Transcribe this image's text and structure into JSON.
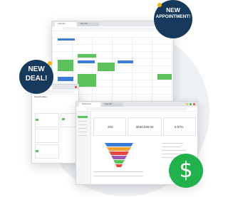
{
  "badges": {
    "appointment": [
      "NEW",
      "APPOINTMENT!"
    ],
    "deal": [
      "NEW",
      "DEAL!"
    ],
    "money_symbol": "$"
  },
  "calendar_window": {
    "tabs": [
      "Calendar",
      "New Tab"
    ]
  },
  "pipeline_window": {
    "tabs": [
      "Deals",
      "New Tab"
    ],
    "title": "Opportunities"
  },
  "dashboard_window": {
    "tabs": [
      "Dashboard",
      "New Tab"
    ],
    "stats": [
      "204",
      "$160,530.00",
      "6.57%"
    ]
  },
  "colors": {
    "navy": "#173a5c",
    "gold": "#f3b40f",
    "green": "#21b24b",
    "event_green": "#5cc35c",
    "event_blue": "#3b7dd8"
  }
}
